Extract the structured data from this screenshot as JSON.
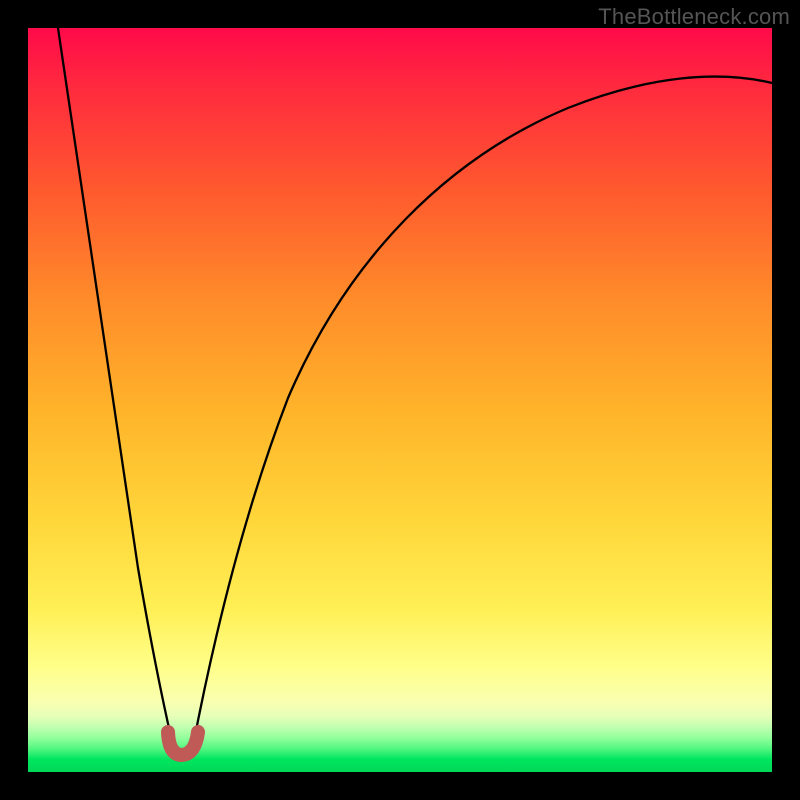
{
  "watermark": "TheBottleneck.com",
  "colors": {
    "top": "#ff0a4a",
    "mid_upper": "#ff6a2a",
    "mid": "#ffb52a",
    "mid_lower": "#ffdb3a",
    "pale_yellow": "#ffff8a",
    "whitish": "#f4ffc8",
    "bottom": "#00e55e",
    "bump": "#c05a57",
    "curve": "#000000",
    "frame": "#000000"
  },
  "chart_data": {
    "type": "line",
    "title": "",
    "xlabel": "",
    "ylabel": "",
    "xlim": [
      0,
      100
    ],
    "ylim": [
      0,
      100
    ],
    "grid": false,
    "legend": false,
    "note": "Bottleneck-style curve in a 744×744 plot area embedded in a 28px black frame. Curve minimum at x≈20. Values are percentage heights read off the image (0 = bottom/green, 100 = top/red).",
    "series": [
      {
        "name": "bottleneck_curve",
        "x": [
          4,
          6,
          8,
          10,
          12,
          14,
          16,
          17,
          18,
          19,
          20,
          21,
          22,
          23,
          24,
          26,
          28,
          30,
          33,
          36,
          40,
          45,
          50,
          55,
          60,
          65,
          70,
          75,
          80,
          85,
          90,
          95,
          100
        ],
        "values": [
          100,
          90,
          80,
          70,
          60,
          48,
          34,
          26,
          17,
          8,
          3,
          3,
          8,
          17,
          25,
          36,
          44,
          50,
          57,
          62,
          67,
          72,
          76,
          79,
          82,
          84,
          86,
          87.5,
          89,
          90,
          91,
          91.8,
          92.5
        ]
      }
    ],
    "valley_marker": {
      "x": 20,
      "y": 2.5,
      "width_x": 4
    }
  }
}
